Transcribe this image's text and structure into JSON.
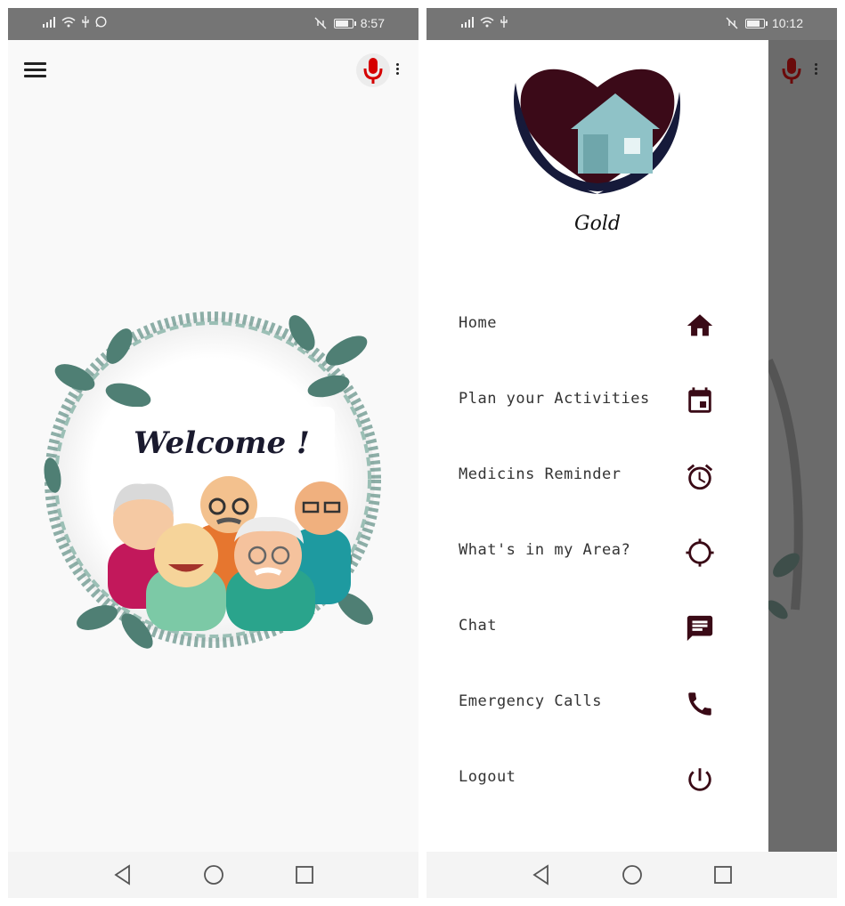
{
  "left_screen": {
    "status_bar": {
      "time": "8:57",
      "left_icons": [
        "signal-icon",
        "wifi-icon",
        "usb-icon",
        "whatsapp-icon"
      ],
      "right_icons": [
        "mute-icon",
        "battery-icon"
      ]
    },
    "app_bar": {
      "menu_icon": "hamburger-icon",
      "mic_icon": "microphone-icon",
      "overflow_icon": "more-vert-icon"
    },
    "welcome_text": "Welcome !",
    "illustration": "elderly-group-in-leaf-wreath",
    "nav_bar": [
      "back-icon",
      "home-circle-icon",
      "recents-square-icon"
    ]
  },
  "right_screen": {
    "status_bar": {
      "time": "10:12",
      "left_icons": [
        "signal-icon",
        "wifi-icon",
        "usb-icon"
      ],
      "right_icons": [
        "mute-icon",
        "battery-icon"
      ]
    },
    "drawer": {
      "logo": "heart-house-hands-logo",
      "brand_name": "Gold",
      "menu": [
        {
          "label": "Home",
          "icon": "home-icon"
        },
        {
          "label": "Plan your Activities",
          "icon": "calendar-icon"
        },
        {
          "label": "Medicins Reminder",
          "icon": "alarm-icon"
        },
        {
          "label": "What's in my Area?",
          "icon": "location-target-icon"
        },
        {
          "label": "Chat",
          "icon": "chat-icon"
        },
        {
          "label": "Emergency Calls",
          "icon": "phone-icon"
        },
        {
          "label": "Logout",
          "icon": "power-icon"
        }
      ]
    },
    "nav_bar": [
      "back-icon",
      "home-circle-icon",
      "recents-square-icon"
    ]
  },
  "colors": {
    "status_bar": "#757575",
    "mic_red": "#d50000",
    "menu_icon_dark": "#3a0a16",
    "logo_heart": "#3b0a18",
    "logo_hands": "#161a3a",
    "logo_house": "#8fc2c7",
    "wreath_leaf": "#4f7f74",
    "scrim": "#6b6b6b"
  }
}
